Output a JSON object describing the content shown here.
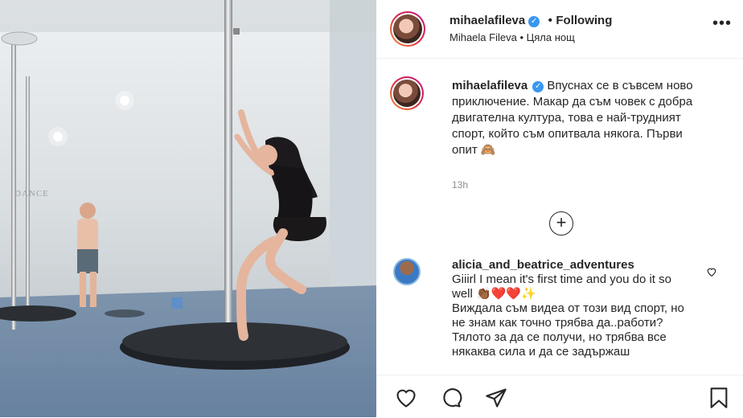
{
  "post": {
    "username": "mihaelafileva",
    "follow_status": "Following",
    "separator": "•",
    "subtitle_name": "Mihaela Fileva",
    "subtitle_song": "Цяла нощ",
    "more_icon": "more-horizontal-icon",
    "verified_icon": "verified-badge-icon"
  },
  "caption": {
    "username": "mihaelafileva",
    "text": "Впуснах се в съвсем ново приключение. Макар да съм човек с добра двигателна култура, това е най-трудният спорт, който съм опитвала някога. Първи опит",
    "emoji": "🙈",
    "time": "13h"
  },
  "load_more": {
    "label": "+"
  },
  "comments": [
    {
      "username": "alicia_and_beatrice_adventures",
      "text_line1": "Giiirl I mean it's first time and you do it so well",
      "emojis": "👏🏾❤️❤️✨",
      "text_line2": "Виждала съм видеа от този вид спорт, но не знам как точно трябва да..работи? Тялото за да се получи, но трябва все някаква сила и да се задържаш",
      "like_icon": "heart-outline-icon"
    }
  ],
  "media": {
    "wall_sign": "DANCE"
  },
  "actions": {
    "like": "heart-icon",
    "comment": "comment-icon",
    "share": "paper-plane-icon",
    "save": "bookmark-icon"
  },
  "colors": {
    "text": "#262626",
    "secondary": "#8e8e8e",
    "verified": "#3897f0",
    "divider": "#efefef"
  }
}
